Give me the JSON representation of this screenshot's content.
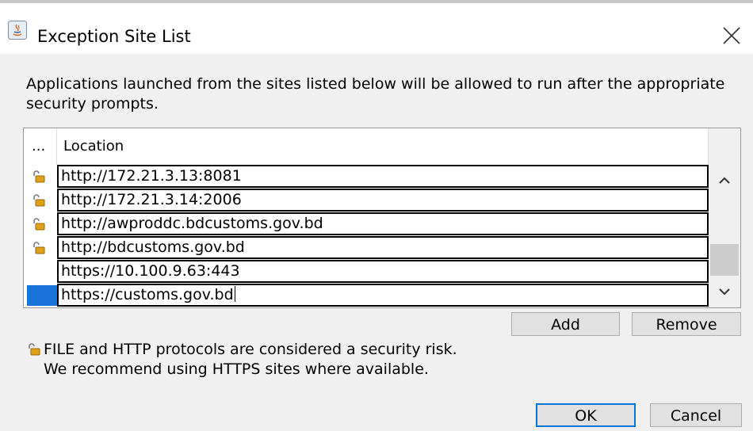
{
  "window": {
    "title": "Exception Site List",
    "icon": "java-icon",
    "close_icon": "close-icon"
  },
  "description": "Applications launched from the sites listed below will be allowed to run after the appropriate security prompts.",
  "table": {
    "columns": [
      "...",
      "Location"
    ],
    "rows": [
      {
        "location": "http://172.21.3.13:8081",
        "icon": "unlocked-padlock-icon"
      },
      {
        "location": "http://172.21.3.14:2006",
        "icon": "unlocked-padlock-icon"
      },
      {
        "location": "http://awproddc.bdcustoms.gov.bd",
        "icon": "unlocked-padlock-icon"
      },
      {
        "location": "http://bdcustoms.gov.bd",
        "icon": "unlocked-padlock-icon"
      },
      {
        "location": "https://10.100.9.63:443",
        "icon": ""
      },
      {
        "location": "https://customs.gov.bd",
        "icon": "",
        "selected": true,
        "editing": true
      }
    ]
  },
  "buttons": {
    "add": "Add",
    "remove": "Remove",
    "ok": "OK",
    "cancel": "Cancel"
  },
  "warning": {
    "icon": "unlocked-padlock-icon",
    "line1": "FILE and HTTP protocols are considered a security risk.",
    "line2": "We recommend using HTTPS sites where available."
  },
  "colors": {
    "selection": "#1a73d9",
    "default_button_border": "#0078d7",
    "titlebar": "#ffffff",
    "dialog_background": "#f0f0f0"
  }
}
